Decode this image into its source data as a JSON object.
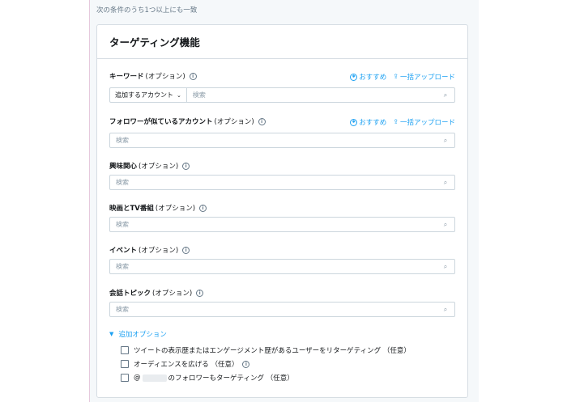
{
  "condition_note": "次の条件のうち1つ以上にも一致",
  "card": {
    "title": "ターゲティング機能"
  },
  "common": {
    "optional": "(オプション)",
    "info_glyph": "i",
    "search_placeholder": "検索",
    "recommend": "おすすめ",
    "bulk_upload": "一括アップロード"
  },
  "fields": {
    "keyword": {
      "label": "キーワード",
      "dropdown": "追加するアカウント"
    },
    "follower_lookalike": {
      "label": "フォロワーが似ているアカウント"
    },
    "interests": {
      "label": "興味関心"
    },
    "movies_tv": {
      "label": "映画とTV番組"
    },
    "events": {
      "label": "イベント"
    },
    "conversation_topics": {
      "label": "会話トピック"
    }
  },
  "additional": {
    "toggle_label": "追加オプション",
    "options": [
      {
        "label": "ツイートの表示歴またはエンゲージメント歴があるユーザーをリターゲティング （任意）",
        "checked": false
      },
      {
        "label": "オーディエンスを広げる （任意）",
        "checked": false
      },
      {
        "label_prefix": "@",
        "label_suffix": "のフォロワーもターゲティング （任意）",
        "checked": false
      }
    ]
  },
  "icons": {
    "info": "info-circle-icon",
    "search": "magnifier-icon",
    "chevron": "chevron-down-icon",
    "recommend": "lightbulb-circle-icon",
    "upload": "upload-icon",
    "disclosure": "triangle-down-icon"
  },
  "colors": {
    "accent": "#1da1f2",
    "border": "#ccd6dd",
    "text": "#14171a",
    "muted": "#657786"
  }
}
